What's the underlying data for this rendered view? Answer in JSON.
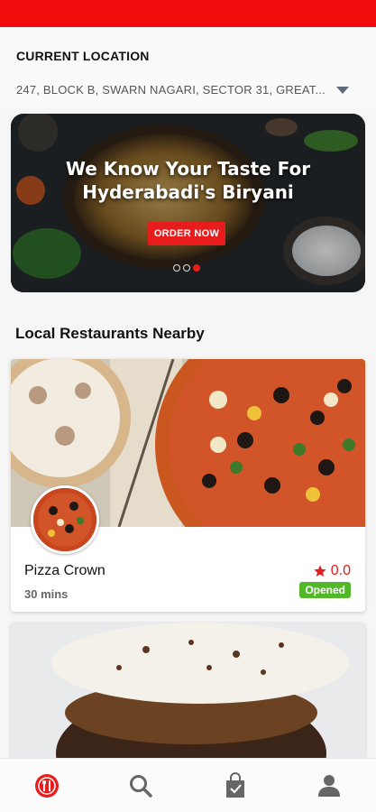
{
  "location": {
    "title": "CURRENT LOCATION",
    "address": "247, BLOCK B, SWARN NAGARI, SECTOR 31, GREAT...",
    "caret_icon": "chevron-down-icon"
  },
  "banner": {
    "title_line1": "We Know Your Taste For",
    "title_line2": "Hyderabadi's Biryani",
    "button_label": "ORDER NOW",
    "slides_total": 3,
    "active_slide": 3
  },
  "section": {
    "title": "Local Restaurants Nearby"
  },
  "restaurants": [
    {
      "name": "Pizza Crown",
      "time": "30 mins",
      "rating": "0.0",
      "status": "Opened"
    }
  ],
  "bottom_nav": [
    {
      "icon": "restaurant-icon",
      "active": true
    },
    {
      "icon": "search-icon",
      "active": false
    },
    {
      "icon": "shopping-bag-icon",
      "active": false
    },
    {
      "icon": "profile-icon",
      "active": false
    }
  ],
  "colors": {
    "accent": "#f20d0d",
    "status_open": "#52b82a",
    "rating": "#e01b1b"
  }
}
